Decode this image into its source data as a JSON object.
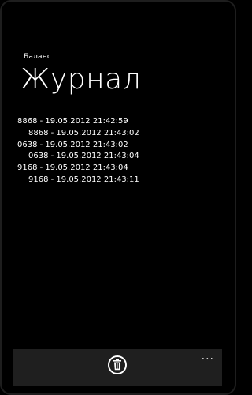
{
  "app": {
    "title": "Баланс",
    "page_title": "Журнал"
  },
  "log": [
    "8868 - 19.05.2012 21:42:59",
    "8868 - 19.05.2012 21:43:02",
    "0638 - 19.05.2012 21:43:02",
    "0638 - 19.05.2012 21:43:04",
    "9168 - 19.05.2012 21:43:04",
    "9168 - 19.05.2012 21:43:11"
  ],
  "app_bar": {
    "delete_icon": "trash-icon",
    "more_label": "..."
  },
  "colors": {
    "background": "#000000",
    "text": "#ffffff",
    "app_bar": "#1f1f1f"
  }
}
